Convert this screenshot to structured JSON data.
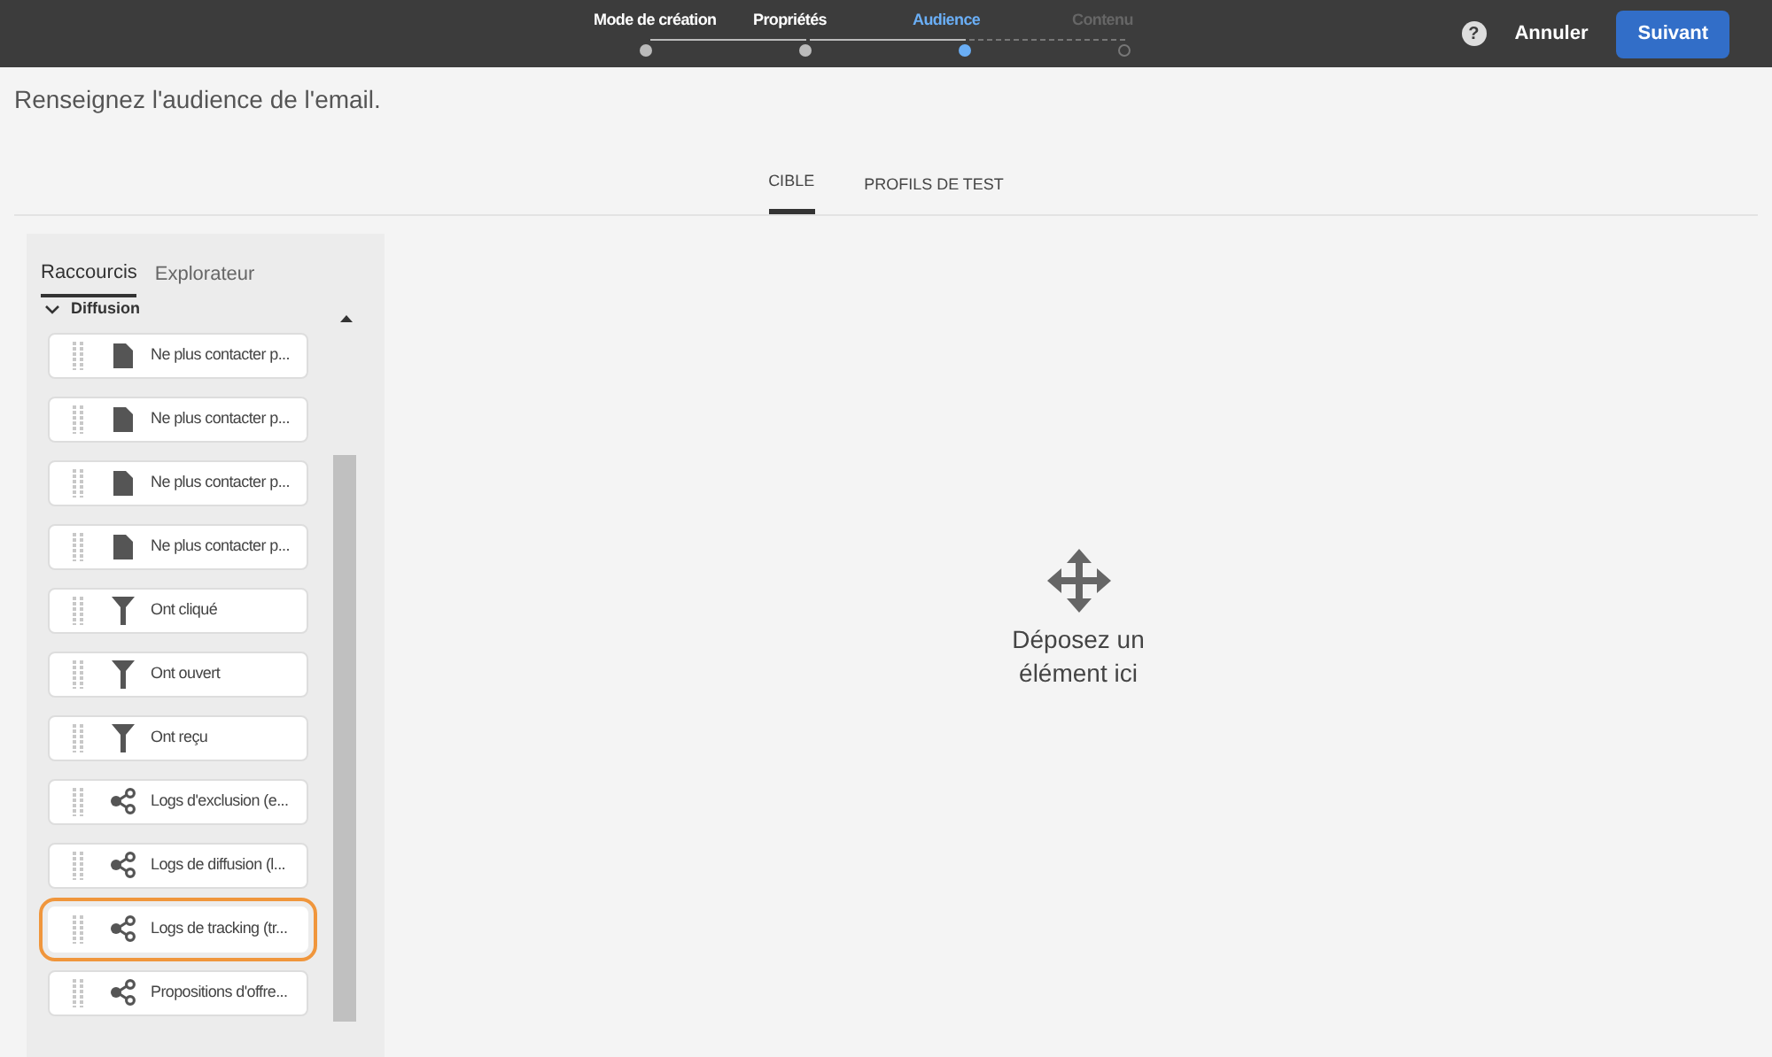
{
  "steps": [
    {
      "label": "Mode de création",
      "completed": true,
      "selected": false
    },
    {
      "label": "Propriétés",
      "completed": true,
      "selected": false
    },
    {
      "label": "Audience",
      "completed": false,
      "selected": true
    },
    {
      "label": "Contenu",
      "completed": false,
      "selected": false
    }
  ],
  "actions": {
    "help": "?",
    "cancel": "Annuler",
    "next": "Suivant"
  },
  "heading": "Renseignez l'audience de l'email.",
  "tabs": [
    {
      "label": "CIBLE",
      "selected": true
    },
    {
      "label": "PROFILS DE TEST",
      "selected": false
    }
  ],
  "panel_tabs": [
    {
      "label": "Raccourcis",
      "selected": true
    },
    {
      "label": "Explorateur",
      "selected": false
    }
  ],
  "section": {
    "title": "Diffusion",
    "expanded": true
  },
  "items": [
    {
      "label": "Ne plus contacter p...",
      "kind": "document",
      "highlighted": false
    },
    {
      "label": "Ne plus contacter p...",
      "kind": "document",
      "highlighted": false
    },
    {
      "label": "Ne plus contacter p...",
      "kind": "document",
      "highlighted": false
    },
    {
      "label": "Ne plus contacter p...",
      "kind": "document",
      "highlighted": false
    },
    {
      "label": "Ont cliqué",
      "kind": "filter",
      "highlighted": false
    },
    {
      "label": "Ont ouvert",
      "kind": "filter",
      "highlighted": false
    },
    {
      "label": "Ont reçu",
      "kind": "filter",
      "highlighted": false
    },
    {
      "label": "Logs d'exclusion (e...",
      "kind": "link",
      "highlighted": false
    },
    {
      "label": "Logs de diffusion (l...",
      "kind": "link",
      "highlighted": false
    },
    {
      "label": "Logs de tracking (tr...",
      "kind": "link",
      "highlighted": true
    },
    {
      "label": "Propositions d'offre...",
      "kind": "link",
      "highlighted": false
    }
  ],
  "drop_zone": {
    "text": "Déposez un élément ici"
  }
}
